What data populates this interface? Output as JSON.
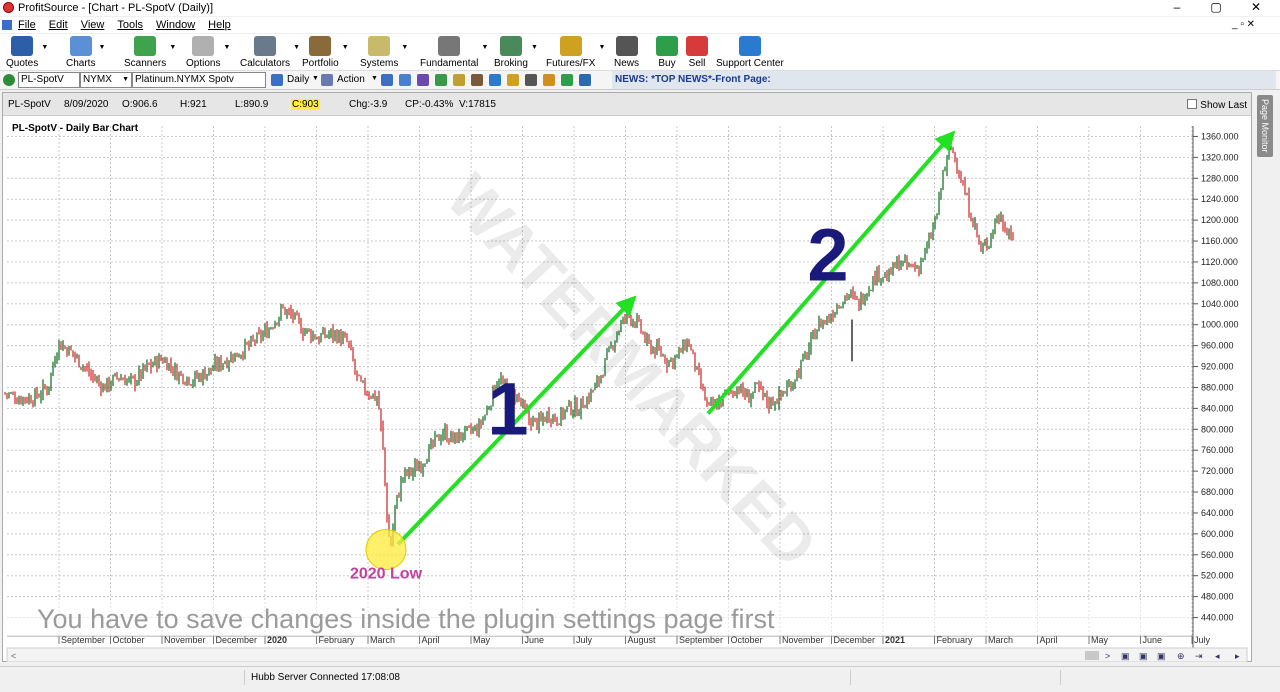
{
  "window": {
    "title": "ProfitSource - [Chart - PL-SpotV (Daily)]",
    "controls": [
      "–",
      "▢",
      "✕"
    ],
    "mdi_controls": "_ ▫ ✕"
  },
  "menu": [
    "File",
    "Edit",
    "View",
    "Tools",
    "Window",
    "Help"
  ],
  "toolbar": [
    {
      "label": "Quotes",
      "icon": "quotes-icon",
      "color": "#2d5ea8"
    },
    {
      "label": "Charts",
      "icon": "charts-icon",
      "color": "#5b8fd6"
    },
    {
      "label": "Scanners",
      "icon": "scanners-icon",
      "color": "#3fa34d"
    },
    {
      "label": "Options",
      "icon": "options-icon",
      "color": "#b0b0b0"
    },
    {
      "label": "Calculators",
      "icon": "calculators-icon",
      "color": "#6a7a8a"
    },
    {
      "label": "Portfolio",
      "icon": "portfolio-icon",
      "color": "#8a6a3a"
    },
    {
      "label": "Systems",
      "icon": "systems-icon",
      "color": "#c9b96a"
    },
    {
      "label": "Fundamental",
      "icon": "fundamental-icon",
      "color": "#777777"
    },
    {
      "label": "Broking",
      "icon": "broking-icon",
      "color": "#4a8a5a"
    },
    {
      "label": "Futures/FX",
      "icon": "futures-icon",
      "color": "#d0a020"
    },
    {
      "label": "News",
      "icon": "news-icon",
      "color": "#555555"
    },
    {
      "label": "Buy",
      "icon": "buy-icon",
      "color": "#2e9e4a"
    },
    {
      "label": "Sell",
      "icon": "sell-icon",
      "color": "#d63a3a"
    },
    {
      "label": "Support Center",
      "icon": "support-icon",
      "color": "#2a7ad0"
    }
  ],
  "toolbar2": {
    "symbol": "PL-SpotV",
    "exchange": "NYMX",
    "name": "Platinum.NYMX Spotv",
    "period": "Daily",
    "action": "Action"
  },
  "news": {
    "text": "NEWS: *TOP NEWS*-Front Page:"
  },
  "info": {
    "symbol": "PL-SpotV",
    "date": "8/09/2020",
    "open": "O:906.6",
    "high": "H:921",
    "low": "L:890.9",
    "close": "C:903",
    "chg": "Chg:-3.9",
    "cp": "CP:-0.43%",
    "vol": "V:17815",
    "show_last": "Show Last"
  },
  "side_tab": "Page Monitor",
  "chart_data": {
    "type": "ohlc",
    "title": "PL-SpotV - Daily Bar Chart",
    "ylim": [
      420,
      1380
    ],
    "y_ticks": [
      440,
      480,
      520,
      560,
      600,
      640,
      680,
      720,
      760,
      800,
      840,
      880,
      920,
      960,
      1000,
      1040,
      1080,
      1120,
      1160,
      1200,
      1240,
      1280,
      1320,
      1360
    ],
    "x_ticks": [
      "September",
      "October",
      "November",
      "December",
      "2020",
      "February",
      "March",
      "April",
      "May",
      "June",
      "July",
      "August",
      "September",
      "October",
      "November",
      "December",
      "2021",
      "February",
      "March",
      "April",
      "May",
      "June",
      "July"
    ],
    "bold_ticks": [
      "2020",
      "2021"
    ],
    "price_path": [
      [
        0,
        870
      ],
      [
        15,
        860
      ],
      [
        30,
        860
      ],
      [
        45,
        880
      ],
      [
        55,
        965
      ],
      [
        70,
        945
      ],
      [
        85,
        910
      ],
      [
        100,
        880
      ],
      [
        115,
        900
      ],
      [
        130,
        890
      ],
      [
        145,
        920
      ],
      [
        160,
        935
      ],
      [
        175,
        905
      ],
      [
        190,
        895
      ],
      [
        205,
        910
      ],
      [
        220,
        930
      ],
      [
        235,
        945
      ],
      [
        250,
        965
      ],
      [
        265,
        990
      ],
      [
        280,
        1030
      ],
      [
        290,
        1015
      ],
      [
        300,
        990
      ],
      [
        315,
        975
      ],
      [
        330,
        985
      ],
      [
        345,
        965
      ],
      [
        355,
        890
      ],
      [
        365,
        870
      ],
      [
        375,
        860
      ],
      [
        380,
        760
      ],
      [
        385,
        600
      ],
      [
        388,
        580
      ],
      [
        392,
        650
      ],
      [
        400,
        710
      ],
      [
        410,
        720
      ],
      [
        420,
        740
      ],
      [
        430,
        770
      ],
      [
        440,
        795
      ],
      [
        450,
        780
      ],
      [
        460,
        790
      ],
      [
        475,
        800
      ],
      [
        485,
        840
      ],
      [
        495,
        900
      ],
      [
        505,
        870
      ],
      [
        515,
        860
      ],
      [
        525,
        820
      ],
      [
        535,
        810
      ],
      [
        545,
        830
      ],
      [
        555,
        820
      ],
      [
        565,
        840
      ],
      [
        575,
        840
      ],
      [
        585,
        860
      ],
      [
        595,
        890
      ],
      [
        605,
        940
      ],
      [
        615,
        990
      ],
      [
        625,
        1020
      ],
      [
        635,
        1000
      ],
      [
        645,
        960
      ],
      [
        655,
        950
      ],
      [
        665,
        930
      ],
      [
        675,
        940
      ],
      [
        685,
        970
      ],
      [
        695,
        900
      ],
      [
        705,
        840
      ],
      [
        715,
        850
      ],
      [
        725,
        870
      ],
      [
        735,
        880
      ],
      [
        745,
        860
      ],
      [
        755,
        880
      ],
      [
        765,
        850
      ],
      [
        775,
        860
      ],
      [
        785,
        880
      ],
      [
        795,
        910
      ],
      [
        805,
        950
      ],
      [
        815,
        1000
      ],
      [
        825,
        1010
      ],
      [
        835,
        1040
      ],
      [
        845,
        1060
      ],
      [
        855,
        1040
      ],
      [
        865,
        1070
      ],
      [
        875,
        1100
      ],
      [
        885,
        1090
      ],
      [
        895,
        1120
      ],
      [
        905,
        1110
      ],
      [
        915,
        1110
      ],
      [
        925,
        1150
      ],
      [
        935,
        1220
      ],
      [
        940,
        1290
      ],
      [
        948,
        1340
      ],
      [
        955,
        1300
      ],
      [
        962,
        1250
      ],
      [
        970,
        1200
      ],
      [
        978,
        1140
      ],
      [
        986,
        1160
      ],
      [
        994,
        1210
      ],
      [
        1002,
        1190
      ],
      [
        1010,
        1170
      ]
    ],
    "annotations": [
      {
        "type": "arrow",
        "from": [
          395,
          580
        ],
        "to": [
          628,
          1045
        ],
        "color": "#22e022"
      },
      {
        "type": "arrow",
        "from": [
          705,
          830
        ],
        "to": [
          947,
          1360
        ],
        "color": "#22e022"
      },
      {
        "type": "label",
        "text": "1",
        "at": [
          505,
          790
        ],
        "color": "#1a1a7a"
      },
      {
        "type": "label",
        "text": "2",
        "at": [
          825,
          1085
        ],
        "color": "#1a1a7a"
      },
      {
        "type": "circle",
        "at": [
          383,
          570
        ],
        "radius": 20,
        "color": "#ffeb3b"
      },
      {
        "type": "label",
        "text": "2020 Low",
        "at": [
          383,
          515
        ],
        "color": "#c040a0"
      }
    ]
  },
  "watermark": "WATERMARKED",
  "overlay_message": "You have to save changes inside the plugin settings page first",
  "status": {
    "server": "Hubb Server Connected 17:08:08"
  },
  "colors": {
    "up": "#0a6a1a",
    "down": "#d02020",
    "grid": "#c8c8c8",
    "arrow": "#22e022"
  }
}
